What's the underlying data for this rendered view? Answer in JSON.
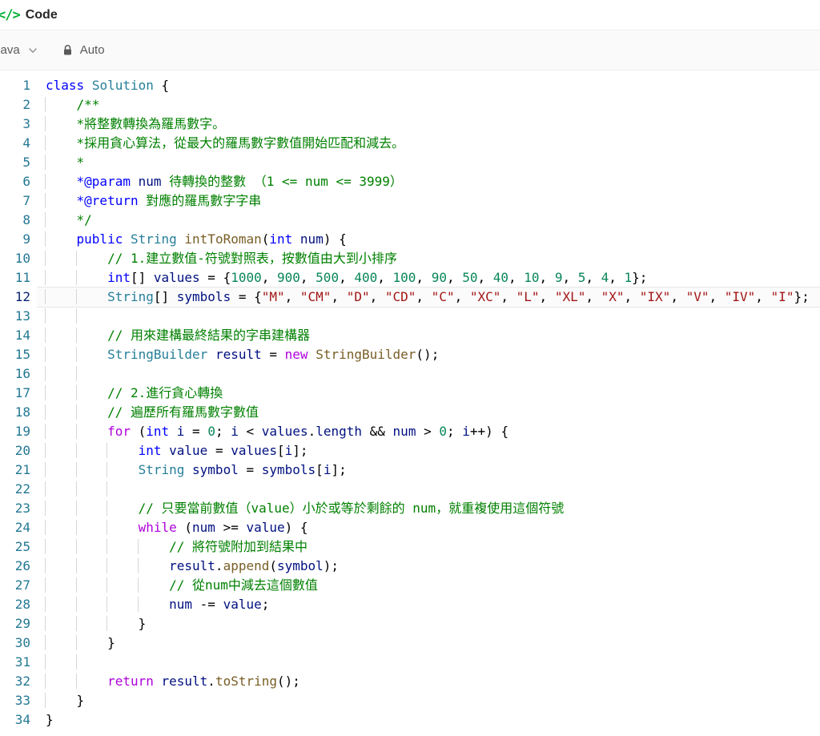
{
  "header": {
    "title": "Code"
  },
  "toolbar": {
    "language": "Java",
    "auto_label": "Auto"
  },
  "editor": {
    "language": "Java",
    "active_line": 12,
    "token_colors": {
      "keyword": "#0000ff",
      "type": "#267f99",
      "function": "#795e26",
      "variable": "#001080",
      "number": "#098658",
      "string": "#a31515",
      "comment": "#008000",
      "control": "#af00db",
      "plain": "#000000",
      "line_number": "#237893",
      "active_line_number": "#0b216f",
      "accent_green": "#00af35"
    },
    "lines": [
      {
        "num": 1,
        "ind": 0,
        "tokens": [
          [
            "k",
            "class"
          ],
          [
            "p",
            " "
          ],
          [
            "t",
            "Solution"
          ],
          [
            "p",
            " {"
          ]
        ]
      },
      {
        "num": 2,
        "ind": 1,
        "tokens": [
          [
            "c",
            "/**"
          ]
        ]
      },
      {
        "num": 3,
        "ind": 1,
        "tokens": [
          [
            "c",
            "*將整數轉換為羅馬數字。"
          ]
        ]
      },
      {
        "num": 4,
        "ind": 1,
        "tokens": [
          [
            "c",
            "*採用貪心算法，從最大的羅馬數字數值開始匹配和減去。"
          ]
        ]
      },
      {
        "num": 5,
        "ind": 1,
        "tokens": [
          [
            "c",
            "*"
          ]
        ]
      },
      {
        "num": 6,
        "ind": 1,
        "tokens": [
          [
            "k",
            "*@param"
          ],
          [
            "c",
            " "
          ],
          [
            "v",
            "num"
          ],
          [
            "c",
            " 待轉換的整數 （1 <= num <= 3999）"
          ]
        ]
      },
      {
        "num": 7,
        "ind": 1,
        "tokens": [
          [
            "k",
            "*@return"
          ],
          [
            "c",
            " 對應的羅馬數字字串"
          ]
        ]
      },
      {
        "num": 8,
        "ind": 1,
        "tokens": [
          [
            "c",
            "*/"
          ]
        ]
      },
      {
        "num": 9,
        "ind": 1,
        "tokens": [
          [
            "k",
            "public"
          ],
          [
            "p",
            " "
          ],
          [
            "t",
            "String"
          ],
          [
            "p",
            " "
          ],
          [
            "f",
            "intToRoman"
          ],
          [
            "p",
            "("
          ],
          [
            "k",
            "int"
          ],
          [
            "p",
            " "
          ],
          [
            "v",
            "num"
          ],
          [
            "p",
            ") {"
          ]
        ]
      },
      {
        "num": 10,
        "ind": 2,
        "tokens": [
          [
            "c",
            "// 1.建立數值-符號對照表，按數值由大到小排序"
          ]
        ]
      },
      {
        "num": 11,
        "ind": 2,
        "tokens": [
          [
            "k",
            "int"
          ],
          [
            "p",
            "[] "
          ],
          [
            "v",
            "values"
          ],
          [
            "p",
            " = {"
          ],
          [
            "n",
            "1000"
          ],
          [
            "p",
            ", "
          ],
          [
            "n",
            "900"
          ],
          [
            "p",
            ", "
          ],
          [
            "n",
            "500"
          ],
          [
            "p",
            ", "
          ],
          [
            "n",
            "400"
          ],
          [
            "p",
            ", "
          ],
          [
            "n",
            "100"
          ],
          [
            "p",
            ", "
          ],
          [
            "n",
            "90"
          ],
          [
            "p",
            ", "
          ],
          [
            "n",
            "50"
          ],
          [
            "p",
            ", "
          ],
          [
            "n",
            "40"
          ],
          [
            "p",
            ", "
          ],
          [
            "n",
            "10"
          ],
          [
            "p",
            ", "
          ],
          [
            "n",
            "9"
          ],
          [
            "p",
            ", "
          ],
          [
            "n",
            "5"
          ],
          [
            "p",
            ", "
          ],
          [
            "n",
            "4"
          ],
          [
            "p",
            ", "
          ],
          [
            "n",
            "1"
          ],
          [
            "p",
            "};"
          ]
        ]
      },
      {
        "num": 12,
        "ind": 2,
        "active": true,
        "tokens": [
          [
            "t",
            "String"
          ],
          [
            "p",
            "[] "
          ],
          [
            "v",
            "symbols"
          ],
          [
            "p",
            " = {"
          ],
          [
            "s",
            "\"M\""
          ],
          [
            "p",
            ", "
          ],
          [
            "s",
            "\"CM\""
          ],
          [
            "p",
            ", "
          ],
          [
            "s",
            "\"D\""
          ],
          [
            "p",
            ", "
          ],
          [
            "s",
            "\"CD\""
          ],
          [
            "p",
            ", "
          ],
          [
            "s",
            "\"C\""
          ],
          [
            "p",
            ", "
          ],
          [
            "s",
            "\"XC\""
          ],
          [
            "p",
            ", "
          ],
          [
            "s",
            "\"L\""
          ],
          [
            "p",
            ", "
          ],
          [
            "s",
            "\"XL\""
          ],
          [
            "p",
            ", "
          ],
          [
            "s",
            "\"X\""
          ],
          [
            "p",
            ", "
          ],
          [
            "s",
            "\"IX\""
          ],
          [
            "p",
            ", "
          ],
          [
            "s",
            "\"V\""
          ],
          [
            "p",
            ", "
          ],
          [
            "s",
            "\"IV\""
          ],
          [
            "p",
            ", "
          ],
          [
            "s",
            "\"I\""
          ],
          [
            "p",
            "};"
          ]
        ]
      },
      {
        "num": 13,
        "ind": 2,
        "tokens": []
      },
      {
        "num": 14,
        "ind": 2,
        "tokens": [
          [
            "c",
            "// 用來建構最終結果的字串建構器"
          ]
        ]
      },
      {
        "num": 15,
        "ind": 2,
        "tokens": [
          [
            "t",
            "StringBuilder"
          ],
          [
            "p",
            " "
          ],
          [
            "v",
            "result"
          ],
          [
            "p",
            " = "
          ],
          [
            "m",
            "new"
          ],
          [
            "p",
            " "
          ],
          [
            "f",
            "StringBuilder"
          ],
          [
            "p",
            "();"
          ]
        ]
      },
      {
        "num": 16,
        "ind": 2,
        "tokens": []
      },
      {
        "num": 17,
        "ind": 2,
        "tokens": [
          [
            "c",
            "// 2.進行貪心轉換"
          ]
        ]
      },
      {
        "num": 18,
        "ind": 2,
        "tokens": [
          [
            "c",
            "// 遍歷所有羅馬數字數值"
          ]
        ]
      },
      {
        "num": 19,
        "ind": 2,
        "tokens": [
          [
            "m",
            "for"
          ],
          [
            "p",
            " ("
          ],
          [
            "k",
            "int"
          ],
          [
            "p",
            " "
          ],
          [
            "v",
            "i"
          ],
          [
            "p",
            " = "
          ],
          [
            "n",
            "0"
          ],
          [
            "p",
            "; "
          ],
          [
            "v",
            "i"
          ],
          [
            "p",
            " < "
          ],
          [
            "v",
            "values"
          ],
          [
            "p",
            "."
          ],
          [
            "v",
            "length"
          ],
          [
            "p",
            " && "
          ],
          [
            "v",
            "num"
          ],
          [
            "p",
            " > "
          ],
          [
            "n",
            "0"
          ],
          [
            "p",
            "; "
          ],
          [
            "v",
            "i"
          ],
          [
            "p",
            "++) {"
          ]
        ]
      },
      {
        "num": 20,
        "ind": 3,
        "tokens": [
          [
            "k",
            "int"
          ],
          [
            "p",
            " "
          ],
          [
            "v",
            "value"
          ],
          [
            "p",
            " = "
          ],
          [
            "v",
            "values"
          ],
          [
            "p",
            "["
          ],
          [
            "v",
            "i"
          ],
          [
            "p",
            "];"
          ]
        ]
      },
      {
        "num": 21,
        "ind": 3,
        "tokens": [
          [
            "t",
            "String"
          ],
          [
            "p",
            " "
          ],
          [
            "v",
            "symbol"
          ],
          [
            "p",
            " = "
          ],
          [
            "v",
            "symbols"
          ],
          [
            "p",
            "["
          ],
          [
            "v",
            "i"
          ],
          [
            "p",
            "];"
          ]
        ]
      },
      {
        "num": 22,
        "ind": 3,
        "tokens": []
      },
      {
        "num": 23,
        "ind": 3,
        "tokens": [
          [
            "c",
            "// 只要當前數值（value）小於或等於剩餘的 num，就重複使用這個符號"
          ]
        ]
      },
      {
        "num": 24,
        "ind": 3,
        "tokens": [
          [
            "m",
            "while"
          ],
          [
            "p",
            " ("
          ],
          [
            "v",
            "num"
          ],
          [
            "p",
            " >= "
          ],
          [
            "v",
            "value"
          ],
          [
            "p",
            ") {"
          ]
        ]
      },
      {
        "num": 25,
        "ind": 4,
        "tokens": [
          [
            "c",
            "// 將符號附加到結果中"
          ]
        ]
      },
      {
        "num": 26,
        "ind": 4,
        "tokens": [
          [
            "v",
            "result"
          ],
          [
            "p",
            "."
          ],
          [
            "f",
            "append"
          ],
          [
            "p",
            "("
          ],
          [
            "v",
            "symbol"
          ],
          [
            "p",
            ");"
          ]
        ]
      },
      {
        "num": 27,
        "ind": 4,
        "tokens": [
          [
            "c",
            "// 從num中減去這個數值"
          ]
        ]
      },
      {
        "num": 28,
        "ind": 4,
        "tokens": [
          [
            "v",
            "num"
          ],
          [
            "p",
            " -= "
          ],
          [
            "v",
            "value"
          ],
          [
            "p",
            ";"
          ]
        ]
      },
      {
        "num": 29,
        "ind": 3,
        "tokens": [
          [
            "p",
            "}"
          ]
        ]
      },
      {
        "num": 30,
        "ind": 2,
        "tokens": [
          [
            "p",
            "}"
          ]
        ]
      },
      {
        "num": 31,
        "ind": 2,
        "tokens": []
      },
      {
        "num": 32,
        "ind": 2,
        "tokens": [
          [
            "m",
            "return"
          ],
          [
            "p",
            " "
          ],
          [
            "v",
            "result"
          ],
          [
            "p",
            "."
          ],
          [
            "f",
            "toString"
          ],
          [
            "p",
            "();"
          ]
        ]
      },
      {
        "num": 33,
        "ind": 1,
        "tokens": [
          [
            "p",
            "}"
          ]
        ]
      },
      {
        "num": 34,
        "ind": 0,
        "tokens": [
          [
            "p",
            "}"
          ]
        ]
      }
    ]
  }
}
